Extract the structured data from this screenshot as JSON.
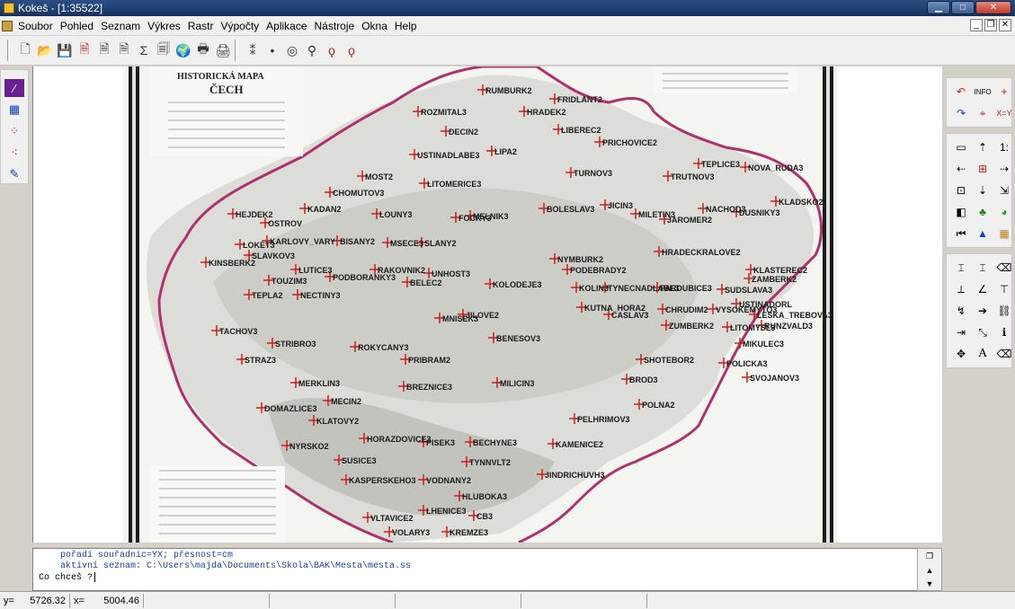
{
  "titlebar": {
    "title": "Kokeš - [1:35522]"
  },
  "menu": [
    "Soubor",
    "Pohled",
    "Seznam",
    "Výkres",
    "Rastr",
    "Výpočty",
    "Aplikace",
    "Nástroje",
    "Okna",
    "Help"
  ],
  "map": {
    "header_title": "HISTORICKÁ MAPA",
    "header_subtitle": "ČECH",
    "cities": [
      {
        "name": "RUMBURK2"
      },
      {
        "name": "FRIDLANT2"
      },
      {
        "name": "ROZMITAL3"
      },
      {
        "name": "HRADEK2"
      },
      {
        "name": "DECIN2"
      },
      {
        "name": "LIBEREC2"
      },
      {
        "name": "PRICHOVICE2"
      },
      {
        "name": "LIPA2"
      },
      {
        "name": "USTINADLABE3"
      },
      {
        "name": "TEPLICE3"
      },
      {
        "name": "NOVA_RUDA3"
      },
      {
        "name": "MOST2"
      },
      {
        "name": "TURNOV3"
      },
      {
        "name": "TRUTNOV3"
      },
      {
        "name": "LITOMERICE3"
      },
      {
        "name": "CHOMUTOV3"
      },
      {
        "name": "KLADSKO2"
      },
      {
        "name": "KADAN2"
      },
      {
        "name": "JICIN3"
      },
      {
        "name": "NACHOD3"
      },
      {
        "name": "BOLESLAV3"
      },
      {
        "name": "DUSNIKY3"
      },
      {
        "name": "MELNIK3"
      },
      {
        "name": "MILETIN3"
      },
      {
        "name": "JAROMER2"
      },
      {
        "name": "LOUNY3"
      },
      {
        "name": "FOCKY3"
      },
      {
        "name": "HEJDEK2"
      },
      {
        "name": "OSTROV"
      },
      {
        "name": "LOKET3"
      },
      {
        "name": "KARLOVY_VARY"
      },
      {
        "name": "BISANY2"
      },
      {
        "name": "MSECE3"
      },
      {
        "name": "SLANY2"
      },
      {
        "name": "SLAVKOV3"
      },
      {
        "name": "KINSBERK2"
      },
      {
        "name": "HRADECKRALOVE2"
      },
      {
        "name": "NYMBURK2"
      },
      {
        "name": "PODEBRADY2"
      },
      {
        "name": "LUTICE3"
      },
      {
        "name": "RAKOVNIK2"
      },
      {
        "name": "UNHOST3"
      },
      {
        "name": "KLASTEREC2"
      },
      {
        "name": "ZAMBERK2"
      },
      {
        "name": "TOUZIM3"
      },
      {
        "name": "PODBORANKY3"
      },
      {
        "name": "BELEC2"
      },
      {
        "name": "KOLODEJE3"
      },
      {
        "name": "KOLIN3"
      },
      {
        "name": "TYNECNADLABE3"
      },
      {
        "name": "PARDUBICE3"
      },
      {
        "name": "SUDSLAVA3"
      },
      {
        "name": "TEPLA2"
      },
      {
        "name": "NECTINY3"
      },
      {
        "name": "USTINADORL"
      },
      {
        "name": "KUTNA_HORA2"
      },
      {
        "name": "CASLAV3"
      },
      {
        "name": "CHRUDIM2"
      },
      {
        "name": "VYSOKEMYTO3"
      },
      {
        "name": "LESKA_TREBOVA3"
      },
      {
        "name": "MNISEK3"
      },
      {
        "name": "JILOVE2"
      },
      {
        "name": "TACHOV3"
      },
      {
        "name": "ZUMBERK2"
      },
      {
        "name": "LITOMYSL3"
      },
      {
        "name": "RUNZVALD3"
      },
      {
        "name": "STRIBRO3"
      },
      {
        "name": "BENESOV3"
      },
      {
        "name": "MIKULEC3"
      },
      {
        "name": "ROKYCANY3"
      },
      {
        "name": "STRAZ3"
      },
      {
        "name": "PRIBRAM2"
      },
      {
        "name": "SHOTEBOR2"
      },
      {
        "name": "POLICKA3"
      },
      {
        "name": "SVOJANOV3"
      },
      {
        "name": "MERKLIN3"
      },
      {
        "name": "BREZNICE3"
      },
      {
        "name": "MILICIN3"
      },
      {
        "name": "BROD3"
      },
      {
        "name": "MECIN2"
      },
      {
        "name": "POLNA2"
      },
      {
        "name": "DOMAZLICE3"
      },
      {
        "name": "KLATOVY2"
      },
      {
        "name": "PELHRIMOV3"
      },
      {
        "name": "NYRSKO2"
      },
      {
        "name": "HORAZDOVICE3"
      },
      {
        "name": "PISEK3"
      },
      {
        "name": "BECHYNE3"
      },
      {
        "name": "KAMENICE2"
      },
      {
        "name": "SUSICE3"
      },
      {
        "name": "TYNNVLT2"
      },
      {
        "name": "JINDRICHUVH3"
      },
      {
        "name": "KASPERSKEHO3"
      },
      {
        "name": "VODNANY2"
      },
      {
        "name": "HLUBOKA3"
      },
      {
        "name": "LHENICE3"
      },
      {
        "name": "CB3"
      },
      {
        "name": "VLTAVICE2"
      },
      {
        "name": "VOLARY3"
      },
      {
        "name": "KREMZE3"
      }
    ]
  },
  "console": {
    "line1": "pořadí souřadnic=YX; přesnost=cm",
    "line2": "aktivní seznam: C:\\Users\\majda\\Documents\\Skola\\BAK\\Mesta\\mesta.ss",
    "prompt": "Co chceš ?"
  },
  "status": {
    "y_label": "y=",
    "y_value": "5726.32",
    "x_label": "x=",
    "x_value": "5004.46"
  },
  "colors": {
    "boundary": "#b0306a",
    "cross": "#d01010",
    "title_blue": "#1a3fb0"
  }
}
